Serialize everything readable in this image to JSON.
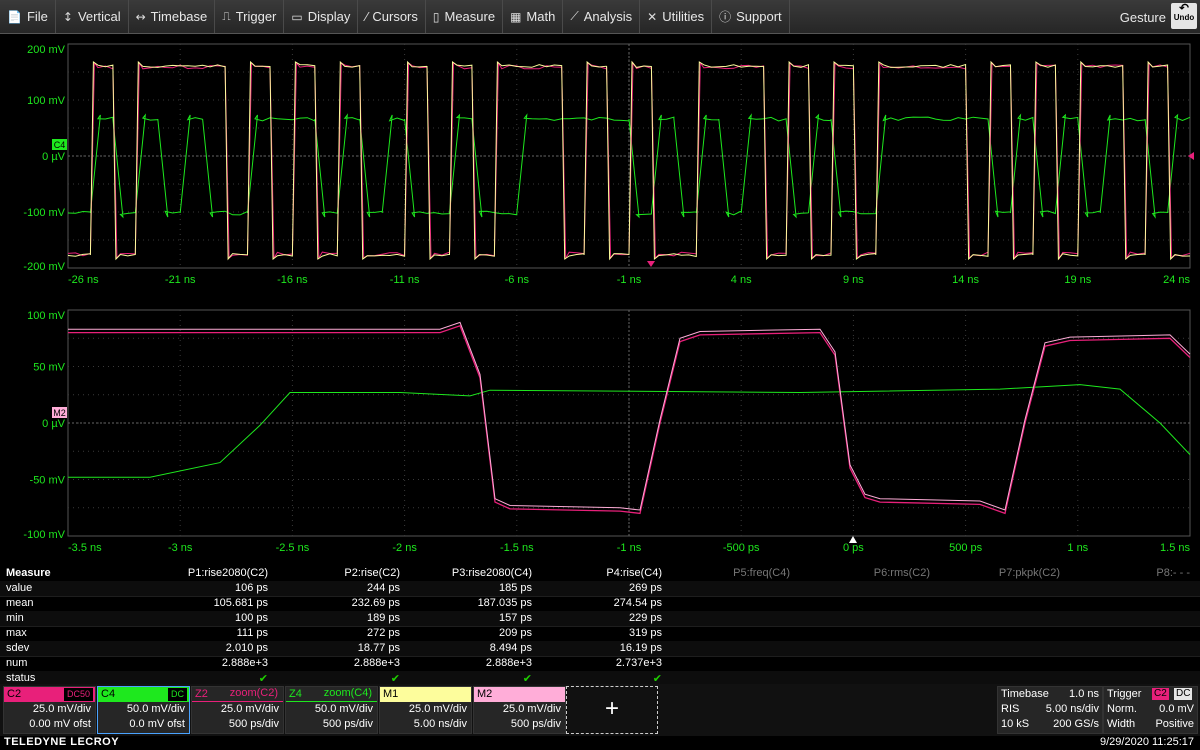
{
  "menu": {
    "items": [
      {
        "name": "file",
        "icon": "📄",
        "label": "File"
      },
      {
        "name": "vertical",
        "icon": "↕",
        "label": "Vertical"
      },
      {
        "name": "timebase",
        "icon": "↔",
        "label": "Timebase"
      },
      {
        "name": "trigger",
        "icon": "⎍",
        "label": "Trigger"
      },
      {
        "name": "display",
        "icon": "▭",
        "label": "Display"
      },
      {
        "name": "cursors",
        "icon": "⁄",
        "label": "Cursors"
      },
      {
        "name": "measure",
        "icon": "▯",
        "label": "Measure"
      },
      {
        "name": "math",
        "icon": "▦",
        "label": "Math"
      },
      {
        "name": "analysis",
        "icon": "⟋",
        "label": "Analysis"
      },
      {
        "name": "utilities",
        "icon": "✕",
        "label": "Utilities"
      },
      {
        "name": "support",
        "icon": "ⓘ",
        "label": "Support"
      }
    ],
    "gesture_label": "Gesture",
    "undo_label": "Undo"
  },
  "grid1": {
    "y_labels": [
      "200 mV",
      "100 mV",
      "0 µV",
      "-100 mV",
      "-200 mV"
    ],
    "x_labels": [
      "-26 ns",
      "-21 ns",
      "-16 ns",
      "-11 ns",
      "-6 ns",
      "-1 ns",
      "4 ns",
      "9 ns",
      "14 ns",
      "19 ns",
      "24 ns"
    ],
    "marker": "C4",
    "bits_C2": [
      0,
      1,
      0,
      1,
      1,
      1,
      1,
      0,
      1,
      0,
      1,
      0,
      1,
      0,
      0,
      1,
      0,
      1,
      0,
      1,
      1,
      1,
      0,
      1,
      0,
      1,
      0,
      0,
      1,
      1,
      1,
      0,
      1,
      0,
      1,
      0,
      1,
      1,
      1,
      1,
      0,
      1,
      0,
      1,
      0,
      1,
      1,
      0,
      1,
      0
    ],
    "bits_C4": [
      0,
      1,
      0,
      1,
      0,
      1,
      0,
      0,
      1,
      1,
      1,
      0,
      1,
      0,
      1,
      0,
      0,
      1,
      0,
      0,
      1,
      1,
      1,
      1,
      1,
      0,
      1,
      0,
      1,
      0,
      1,
      1,
      0,
      1,
      0,
      0,
      1,
      1,
      1,
      1,
      1,
      0,
      1,
      0,
      1,
      0,
      1,
      1,
      0,
      1
    ]
  },
  "grid2": {
    "y_labels": [
      "100 mV",
      "50 mV",
      "0 µV",
      "-50 mV",
      "-100 mV"
    ],
    "x_labels": [
      "-3.5 ns",
      "-3 ns",
      "-2.5 ns",
      "-2 ns",
      "-1.5 ns",
      "-1 ns",
      "-500 ps",
      "0 ps",
      "500 ps",
      "1 ns",
      "1.5 ns"
    ],
    "marker": "M2"
  },
  "measure": {
    "header_label": "Measure",
    "columns": [
      {
        "name": "P1:rise2080(C2)",
        "active": true
      },
      {
        "name": "P2:rise(C2)",
        "active": true
      },
      {
        "name": "P3:rise2080(C4)",
        "active": true
      },
      {
        "name": "P4:rise(C4)",
        "active": true
      },
      {
        "name": "P5:freq(C4)",
        "active": false
      },
      {
        "name": "P6:rms(C2)",
        "active": false
      },
      {
        "name": "P7:pkpk(C2)",
        "active": false
      },
      {
        "name": "P8:- - -",
        "active": false
      }
    ],
    "rows": [
      {
        "label": "value",
        "cells": [
          "106 ps",
          "244 ps",
          "185 ps",
          "269 ps"
        ]
      },
      {
        "label": "mean",
        "cells": [
          "105.681 ps",
          "232.69 ps",
          "187.035 ps",
          "274.54 ps"
        ]
      },
      {
        "label": "min",
        "cells": [
          "100 ps",
          "189 ps",
          "157 ps",
          "229 ps"
        ]
      },
      {
        "label": "max",
        "cells": [
          "111 ps",
          "272 ps",
          "209 ps",
          "319 ps"
        ]
      },
      {
        "label": "sdev",
        "cells": [
          "2.010 ps",
          "18.77 ps",
          "8.494 ps",
          "16.19 ps"
        ]
      },
      {
        "label": "num",
        "cells": [
          "2.888e+3",
          "2.888e+3",
          "2.888e+3",
          "2.737e+3"
        ]
      },
      {
        "label": "status",
        "cells": [
          "✔",
          "✔",
          "✔",
          "✔"
        ]
      }
    ]
  },
  "descriptors": [
    {
      "name": "C2",
      "label": "C2",
      "tag": "DC50",
      "color": "#e8207a",
      "text": "#000",
      "line1": "25.0 mV/div",
      "line2": "0.00 mV ofst"
    },
    {
      "name": "C4",
      "label": "C4",
      "tag": "DC",
      "color": "#1ee81e",
      "text": "#000",
      "line1": "50.0 mV/div",
      "line2": "0.0 mV ofst"
    },
    {
      "name": "Z2",
      "label": "Z2",
      "tag": "zoom(C2)",
      "color": "#e8207a",
      "text": "#e8207a",
      "line1": "25.0 mV/div",
      "line2": "500 ps/div"
    },
    {
      "name": "Z4",
      "label": "Z4",
      "tag": "zoom(C4)",
      "color": "#1ee81e",
      "text": "#1ee81e",
      "line1": "50.0 mV/div",
      "line2": "500 ps/div"
    },
    {
      "name": "M1",
      "label": "M1",
      "tag": "",
      "color": "#fdfd9c",
      "text": "#000",
      "line1": "25.0 mV/div",
      "line2": "5.00 ns/div"
    },
    {
      "name": "M2",
      "label": "M2",
      "tag": "",
      "color": "#ffadd8",
      "text": "#000",
      "line1": "25.0 mV/div",
      "line2": "500 ps/div"
    }
  ],
  "add_label": "+",
  "timebase": {
    "title": "Timebase",
    "delay": "1.0 ns",
    "mode": "RIS",
    "div": "5.00 ns/div",
    "samples": "10 kS",
    "rate": "200 GS/s"
  },
  "trigger": {
    "title": "Trigger",
    "src": "C2",
    "coupling": "DC",
    "mode": "Norm.",
    "level": "0.0 mV",
    "type": "Width",
    "slope": "Positive"
  },
  "footer": {
    "brand": "TELEDYNE LECROY",
    "datetime": "9/29/2020 11:25:17"
  },
  "colors": {
    "c2": "#e8207a",
    "c4": "#1ee81e",
    "m1": "#fdfd9c",
    "m2": "#ffadd8",
    "grid": "#3a3a3a",
    "label": "#1ee81e"
  }
}
